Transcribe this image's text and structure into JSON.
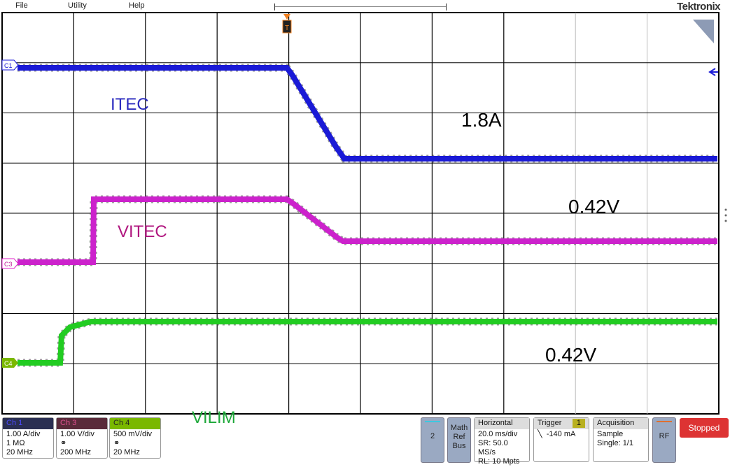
{
  "menu": [
    "File",
    "Utility",
    "Help"
  ],
  "brand": "Tektronix",
  "channels": {
    "c1": {
      "marker": "C1",
      "color": "#1a1ad6"
    },
    "c3": {
      "marker": "C3",
      "color": "#e020c8"
    },
    "c4": {
      "marker": "C4",
      "color": "#22cc22"
    }
  },
  "annotations": {
    "itec_label": "ITEC",
    "itec_label_color": "#2b2bbf",
    "vitec_label": "VITEC",
    "vitec_label_color": "#b0167f",
    "vilim_label": "VILIM",
    "vilim_label_color": "#1ea83a",
    "itec_value": "1.8A",
    "vitec_value": "0.42V",
    "vilim_value": "0.42V"
  },
  "trigger_marker": "T",
  "bottom": {
    "ch1": {
      "title": "Ch 1",
      "scale": "1.00 A/div",
      "impedance": "1 MΩ",
      "bandwidth": "20 MHz",
      "header_color": "#2a2f52"
    },
    "ch3": {
      "title": "Ch 3",
      "scale": "1.00 V/div",
      "bandwidth": "200 MHz",
      "header_color": "#5a2a3a"
    },
    "ch4": {
      "title": "Ch 4",
      "scale": "500 mV/div",
      "bandwidth": "20 MHz",
      "header_color": "#7ab800"
    },
    "btn2": "2",
    "math": [
      "Math",
      "Ref",
      "Bus"
    ],
    "horizontal": {
      "title": "Horizontal",
      "scale": "20.0 ms/div",
      "sr": "SR: 50.0 MS/s",
      "rl": "RL: 10 Mpts"
    },
    "trigger": {
      "title": "Trigger",
      "source": "1",
      "level": "-140 mA"
    },
    "acquisition": {
      "title": "Acquisition",
      "mode": "Sample",
      "single": "Single: 1/1"
    },
    "rf": "RF",
    "status": "Stopped"
  }
}
